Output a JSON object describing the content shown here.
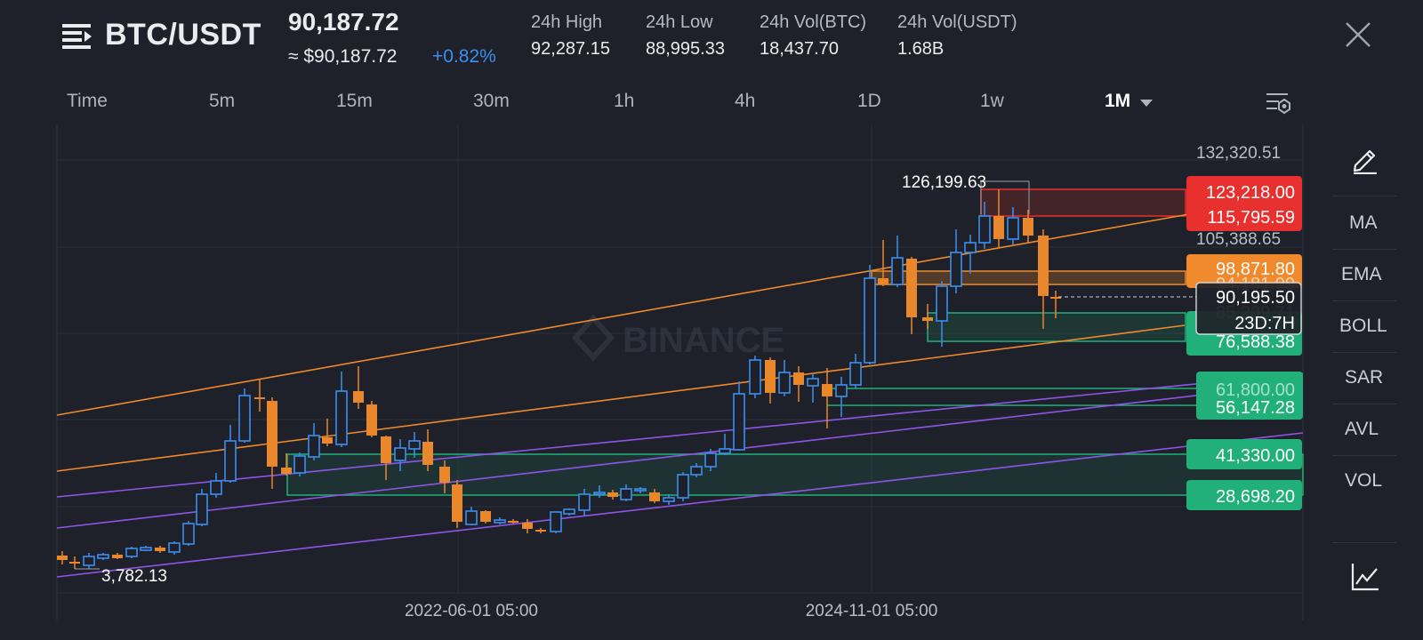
{
  "header": {
    "pair": "BTC/USDT",
    "price": "90,187.72",
    "usd_price": "≈ $90,187.72",
    "change": "+0.82%",
    "stats": [
      {
        "label": "24h High",
        "value": "92,287.15"
      },
      {
        "label": "24h Low",
        "value": "88,995.33"
      },
      {
        "label": "24h Vol(BTC)",
        "value": "18,437.70"
      },
      {
        "label": "24h Vol(USDT)",
        "value": "1.68B"
      }
    ]
  },
  "timeframes": [
    "Time",
    "5m",
    "15m",
    "30m",
    "1h",
    "4h",
    "1D",
    "1w",
    "1M"
  ],
  "active_timeframe": "1M",
  "right_toolbar": [
    "MA",
    "EMA",
    "BOLL",
    "SAR",
    "AVL",
    "VOL"
  ],
  "colors": {
    "background": "#1e2129",
    "up": "#3b8ff0",
    "down": "#e8872c",
    "resistance": "#e8302e",
    "support": "#21b07a",
    "trend_orange": "#f08a2c",
    "trend_purple": "#8f55e6",
    "change_positive": "#3b8ff0"
  },
  "chart_data": {
    "type": "candlestick",
    "watermark": "BINANCE",
    "y_axis_labels": [
      "132,320.51",
      "105,388.65"
    ],
    "x_axis_labels": [
      "2022-06-01 05:00",
      "2024-11-01 05:00"
    ],
    "high_marker": "126,199.63",
    "low_marker": "3,782.13",
    "current_price": "90,195.50",
    "countdown": "23D:7H",
    "levels": [
      {
        "value": "123,218.00",
        "kind": "resistance"
      },
      {
        "value": "115,795.59",
        "kind": "resistance"
      },
      {
        "value": "98,871.80",
        "kind": "orange"
      },
      {
        "value": "94,181.99",
        "kind": "orange"
      },
      {
        "value": "85,209.71",
        "kind": "support"
      },
      {
        "value": "76,588.38",
        "kind": "support"
      },
      {
        "value": "61,800.00",
        "kind": "support"
      },
      {
        "value": "56,147.28",
        "kind": "support"
      },
      {
        "value": "41,330.00",
        "kind": "support"
      },
      {
        "value": "28,698.20",
        "kind": "support"
      }
    ]
  }
}
